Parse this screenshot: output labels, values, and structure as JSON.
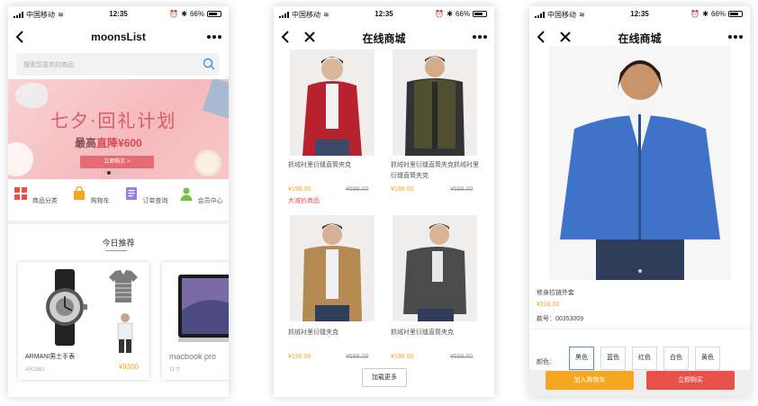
{
  "status": {
    "carrier": "中国移动",
    "time": "12:35",
    "battery": "66%"
  },
  "home": {
    "title": "moonsList",
    "search_placeholder": "搜索您喜欢的商品",
    "banner": {
      "headline": "七夕·回礼计划",
      "subline_prefix": "最高",
      "subline_highlight": "直降¥600",
      "button": "立即购买 >",
      "slide_count": 3,
      "active_slide": 1
    },
    "menu": [
      {
        "label": "商品分类",
        "icon": "grid-icon",
        "color": "#e8504a"
      },
      {
        "label": "购物车",
        "icon": "shopping-bag-icon",
        "color": "#f5a623"
      },
      {
        "label": "订单查询",
        "icon": "order-list-icon",
        "color": "#9b7de6"
      },
      {
        "label": "会员中心",
        "icon": "user-icon",
        "color": "#7ac143"
      }
    ],
    "recommend_title": "今日推荐",
    "cards": [
      {
        "name": "ARMANI男士手表",
        "code": "AR1981",
        "price": "¥9300"
      },
      {
        "name": "macbook pro",
        "code": "11寸"
      }
    ]
  },
  "list": {
    "title": "在线商城",
    "products": [
      {
        "name": "抓绒衬里衍缝直筒夹克",
        "price": "¥198.00",
        "old_price": "¥599.00",
        "tag": "大减价商品",
        "color": "#b8222e"
      },
      {
        "name": "抓绒衬里衍缝直筒夹克抓绒衬里衍缝直筒夹克",
        "price": "¥198.00",
        "old_price": "¥599.00",
        "tag": "",
        "color": "#4f5032"
      },
      {
        "name": "抓绒衬里衍缝夹克",
        "price": "¥198.00",
        "old_price": "¥599.00",
        "tag": "",
        "color": "#b48a52"
      },
      {
        "name": "抓绒衬里衍缝直筒夹克",
        "price": "¥198.00",
        "old_price": "¥599.00",
        "tag": "",
        "color": "#4a4b4a"
      }
    ],
    "load_more": "加载更多"
  },
  "detail": {
    "title": "在线商城",
    "product_name": "修身拉链外套",
    "price": "¥318.00",
    "code": "款号：00353009",
    "color_label": "颜色：",
    "colors": [
      "黑色",
      "蓝色",
      "红色",
      "白色",
      "黄色"
    ],
    "selected_color": "黑色",
    "add_to_cart": "加入购物车",
    "buy_now": "立即购买",
    "image_color": "#3f73c9"
  }
}
